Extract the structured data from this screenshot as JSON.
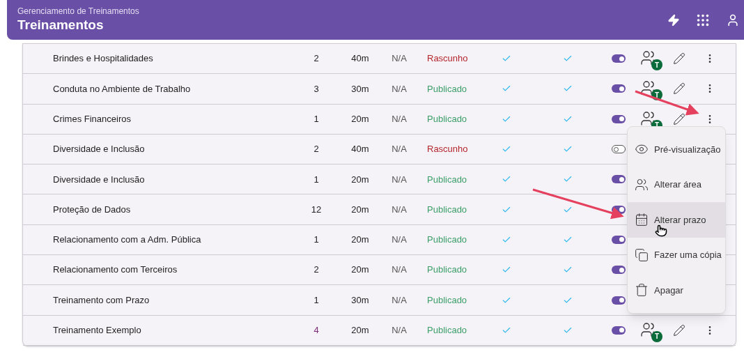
{
  "header": {
    "subtitle": "Gerenciamento de Treinamentos",
    "title": "Treinamentos"
  },
  "rows": [
    {
      "name": "Brindes e Hospitalidades",
      "count": "2",
      "count_emphasized": false,
      "duration": "40m",
      "deadline": "N/A",
      "status": {
        "text": "Rascunho",
        "color": "#b3262d"
      },
      "check_1": true,
      "check_2": true,
      "active": true,
      "actions_covered": false,
      "team_badge": "T"
    },
    {
      "name": "Conduta no Ambiente de Trabalho",
      "count": "3",
      "count_emphasized": false,
      "duration": "30m",
      "deadline": "N/A",
      "status": {
        "text": "Publicado",
        "color": "#3b9e68"
      },
      "check_1": true,
      "check_2": true,
      "active": true,
      "actions_covered": false,
      "team_badge": "T"
    },
    {
      "name": "Crimes Financeiros",
      "count": "1",
      "count_emphasized": false,
      "duration": "20m",
      "deadline": "N/A",
      "status": {
        "text": "Publicado",
        "color": "#3b9e68"
      },
      "check_1": true,
      "check_2": true,
      "active": true,
      "actions_covered": false,
      "team_badge": "T"
    },
    {
      "name": "Diversidade e Inclusão",
      "count": "2",
      "count_emphasized": false,
      "duration": "40m",
      "deadline": "N/A",
      "status": {
        "text": "Rascunho",
        "color": "#b3262d"
      },
      "check_1": true,
      "check_2": true,
      "active": false,
      "actions_covered": true
    },
    {
      "name": "Diversidade e Inclusão",
      "count": "1",
      "count_emphasized": false,
      "duration": "20m",
      "deadline": "N/A",
      "status": {
        "text": "Publicado",
        "color": "#3b9e68"
      },
      "check_1": true,
      "check_2": true,
      "active": true,
      "actions_covered": true
    },
    {
      "name": "Proteção de Dados",
      "count": "12",
      "count_emphasized": false,
      "duration": "20m",
      "deadline": "N/A",
      "status": {
        "text": "Publicado",
        "color": "#3b9e68"
      },
      "check_1": true,
      "check_2": true,
      "active": true,
      "actions_covered": true
    },
    {
      "name": "Relacionamento com a Adm. Pública",
      "count": "1",
      "count_emphasized": false,
      "duration": "20m",
      "deadline": "N/A",
      "status": {
        "text": "Publicado",
        "color": "#3b9e68"
      },
      "check_1": true,
      "check_2": true,
      "active": true,
      "actions_covered": true
    },
    {
      "name": "Relacionamento com Terceiros",
      "count": "2",
      "count_emphasized": false,
      "duration": "20m",
      "deadline": "N/A",
      "status": {
        "text": "Publicado",
        "color": "#3b9e68"
      },
      "check_1": true,
      "check_2": true,
      "active": true,
      "actions_covered": true
    },
    {
      "name": "Treinamento com Prazo",
      "count": "1",
      "count_emphasized": false,
      "duration": "30m",
      "deadline": "N/A",
      "status": {
        "text": "Publicado",
        "color": "#3b9e68"
      },
      "check_1": true,
      "check_2": true,
      "active": true,
      "actions_covered": true
    },
    {
      "name": "Treinamento Exemplo",
      "count": "4",
      "count_emphasized": true,
      "duration": "20m",
      "deadline": "N/A",
      "status": {
        "text": "Publicado",
        "color": "#3b9e68"
      },
      "check_1": true,
      "check_2": true,
      "active": true,
      "actions_covered": false,
      "team_badge": "T"
    }
  ],
  "menu": [
    {
      "kind": "preview",
      "label": "Pré-visualização",
      "highlighted": false
    },
    {
      "kind": "area",
      "label": "Alterar área",
      "highlighted": false
    },
    {
      "kind": "deadline",
      "label": "Alterar prazo",
      "highlighted": true
    },
    {
      "kind": "copy",
      "label": "Fazer uma cópia",
      "highlighted": false
    },
    {
      "kind": "delete",
      "label": "Apagar",
      "highlighted": false
    }
  ]
}
